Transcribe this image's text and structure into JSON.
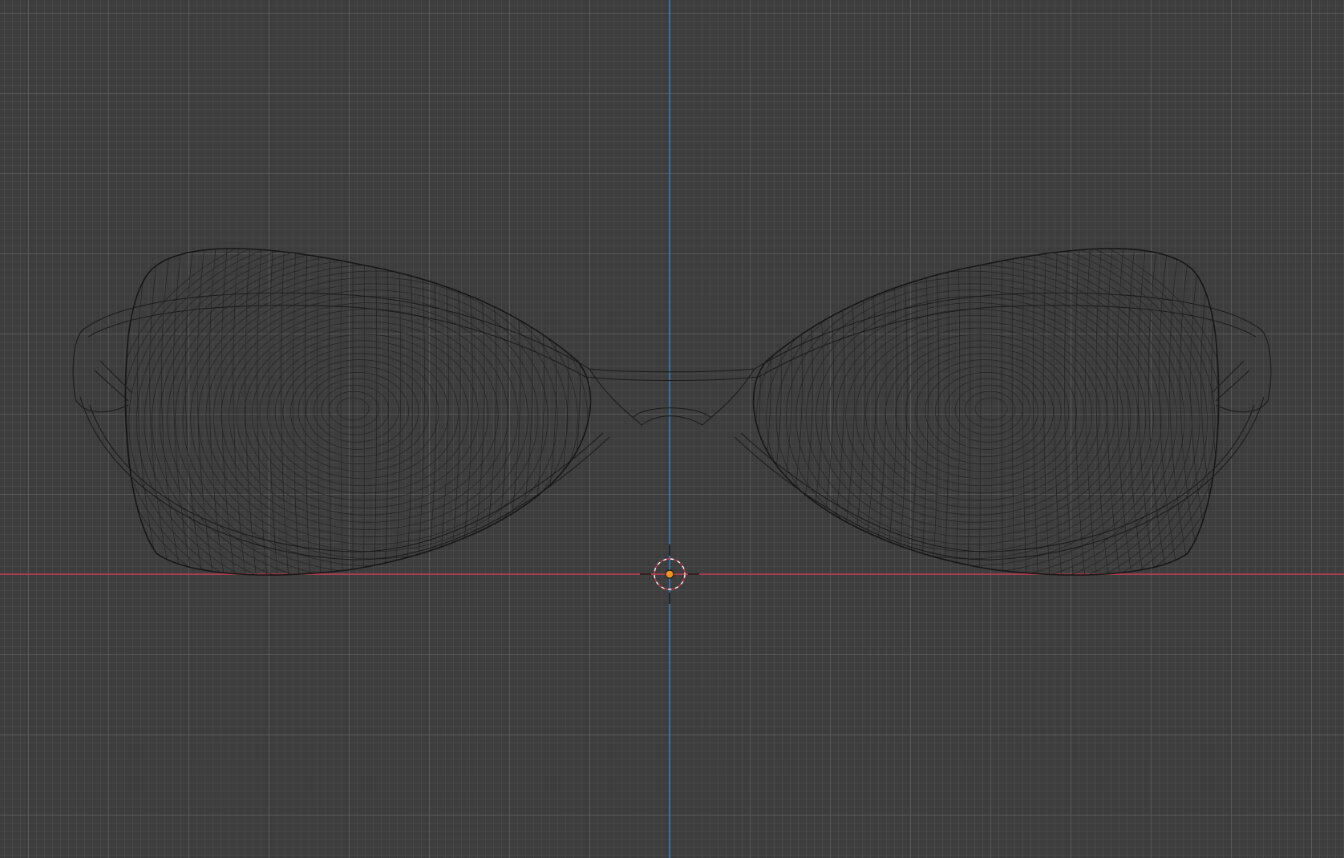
{
  "viewport": {
    "background_color": "#3d3d3d",
    "grid_major_color": "#5f5f5f",
    "grid_minor_color": "#484848",
    "x_axis_color": "#c0394b",
    "z_axis_color": "#2f7fd2",
    "wireframe_color": "#1b1b1b",
    "object_origin_color": "#f0941d",
    "cursor_color": "#ffffff"
  },
  "scene": {
    "object": "glasses-wireframe",
    "icons": [
      "3d-cursor-icon",
      "object-origin-icon"
    ]
  }
}
